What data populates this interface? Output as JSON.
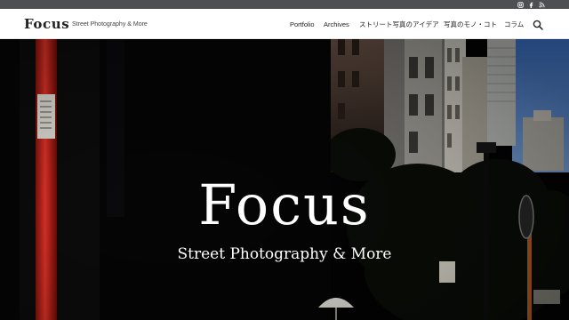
{
  "site": {
    "logo": "Focus",
    "tagline": "Street Photography & More"
  },
  "nav": {
    "items": [
      {
        "label": "Portfolio"
      },
      {
        "label": "Archives"
      },
      {
        "label": "ストリート写真のアイデア"
      },
      {
        "label": "写真のモノ・コト"
      },
      {
        "label": "コラム"
      }
    ]
  },
  "social": {
    "icons": [
      "instagram-icon",
      "facebook-icon",
      "rss-icon"
    ]
  },
  "hero": {
    "title": "Focus",
    "subtitle": "Street Photography & More"
  },
  "colors": {
    "topbar": "#4d4f52",
    "header_bg": "#ffffff",
    "pole_red": "#d9261c",
    "sky": "#4a7fd0",
    "text_white": "#ffffff"
  }
}
